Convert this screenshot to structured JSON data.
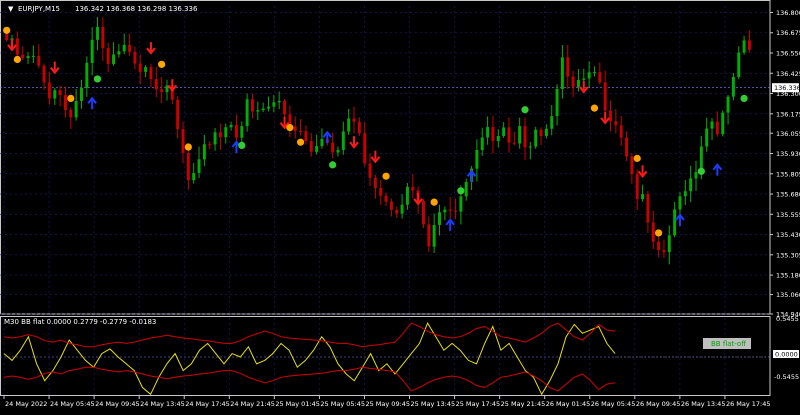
{
  "window": {
    "symbol_label": "EURJPY,M15",
    "ohlc_text": "136.342 136.368 136.298 136.336",
    "menu_glyph": "▼"
  },
  "indicator": {
    "label": "M30 BB flat 0.0000 0.2779 -0.2779 -0.0183",
    "status_badge": "BB flat-off",
    "zero_label": "0.0000",
    "y_labels": [
      "0.5455",
      "-0.5455"
    ]
  },
  "colors": {
    "background": "#000000",
    "grid": "#1c1c7a",
    "bull_candle": "#00b000",
    "bear_candle": "#c80000",
    "buy_arrow": "#1e3cff",
    "sell_arrow": "#ff1a1a",
    "green_dot": "#32cd32",
    "orange_dot": "#ffa500",
    "osc_line": "#e8e000",
    "band_line": "#d40000",
    "axis": "#c8c8c8",
    "current_price_box": "#ffffff",
    "badge_bg": "#bfbfbf",
    "badge_text": "#00a000"
  },
  "chart_data": [
    {
      "type": "candlestick",
      "title": "EURJPY,M15",
      "ylim": [
        134.94,
        136.84
      ],
      "y_ticks": [
        136.8,
        136.675,
        136.55,
        136.425,
        136.3,
        136.175,
        136.055,
        135.93,
        135.805,
        135.68,
        135.555,
        135.43,
        135.305,
        135.18,
        135.06,
        134.94
      ],
      "y_tick_labels": [
        "136.800",
        "136.675",
        "136.550",
        "136.425",
        "136.300",
        "136.175",
        "136.055",
        "135.930",
        "135.805",
        "135.680",
        "135.555",
        "135.430",
        "135.305",
        "135.180",
        "135.060",
        "134.940"
      ],
      "current_price": 136.336,
      "current_price_label": "136.336",
      "x_ticks": [
        "24 May 2022",
        "24 May 05:45",
        "24 May 09:45",
        "24 May 13:45",
        "24 May 17:45",
        "24 May 21:45",
        "25 May 01:45",
        "25 May 05:45",
        "25 May 09:45",
        "25 May 13:45",
        "25 May 17:45",
        "25 May 21:45",
        "26 May 01:45",
        "26 May 05:45",
        "26 May 09:45",
        "26 May 13:45",
        "26 May 17:45"
      ],
      "closes": [
        136.63,
        136.56,
        136.48,
        136.53,
        136.42,
        136.3,
        136.36,
        136.21,
        136.2,
        136.34,
        136.52,
        136.69,
        136.45,
        136.5,
        136.55,
        136.6,
        136.47,
        136.5,
        136.38,
        136.33,
        136.22,
        135.98,
        135.74,
        135.8,
        135.95,
        136.08,
        136.05,
        136.15,
        136.05,
        136.22,
        136.15,
        136.2,
        136.22,
        136.25,
        136.13,
        136.1,
        136.05,
        135.97,
        136.08,
        135.95,
        135.9,
        136.15,
        136.12,
        135.95,
        135.8,
        135.72,
        135.65,
        135.61,
        135.68,
        135.7,
        135.55,
        135.35,
        135.5,
        135.65,
        135.6,
        135.72,
        135.85,
        136.02,
        136.05,
        135.98,
        136.05,
        135.9,
        136.05,
        136.0,
        136.12,
        136.05,
        136.25,
        136.52,
        136.3,
        136.35,
        136.35,
        136.42,
        136.28,
        136.18,
        136.1,
        135.92,
        135.7,
        135.6,
        135.35,
        135.25,
        135.42,
        135.6,
        135.75,
        135.8,
        136.03,
        136.15,
        136.1,
        136.2,
        136.45,
        136.58,
        136.55,
        136.35
      ],
      "signals": [
        {
          "type": "sell_arrow",
          "index": 1,
          "price": 136.6
        },
        {
          "type": "orange_dot",
          "index": 0,
          "price": 136.69
        },
        {
          "type": "orange_dot",
          "index": 2,
          "price": 136.51
        },
        {
          "type": "sell_arrow",
          "index": 9,
          "price": 136.46
        },
        {
          "type": "orange_dot",
          "index": 12,
          "price": 136.27
        },
        {
          "type": "green_dot",
          "index": 17,
          "price": 136.39
        },
        {
          "type": "buy_arrow",
          "index": 16,
          "price": 136.24
        },
        {
          "type": "sell_arrow",
          "index": 27,
          "price": 136.58
        },
        {
          "type": "orange_dot",
          "index": 29,
          "price": 136.48
        },
        {
          "type": "sell_arrow",
          "index": 31,
          "price": 136.35
        },
        {
          "type": "orange_dot",
          "index": 34,
          "price": 135.97
        },
        {
          "type": "buy_arrow",
          "index": 43,
          "price": 135.97
        },
        {
          "type": "green_dot",
          "index": 44,
          "price": 135.98
        },
        {
          "type": "sell_arrow",
          "index": 52,
          "price": 136.12
        },
        {
          "type": "orange_dot",
          "index": 53,
          "price": 136.09
        },
        {
          "type": "orange_dot",
          "index": 55,
          "price": 136.0
        },
        {
          "type": "buy_arrow",
          "index": 60,
          "price": 136.03
        },
        {
          "type": "green_dot",
          "index": 61,
          "price": 135.86
        },
        {
          "type": "sell_arrow",
          "index": 65,
          "price": 136.0
        },
        {
          "type": "sell_arrow",
          "index": 69,
          "price": 135.91
        },
        {
          "type": "orange_dot",
          "index": 71,
          "price": 135.79
        },
        {
          "type": "sell_arrow",
          "index": 77,
          "price": 135.65
        },
        {
          "type": "orange_dot",
          "index": 80,
          "price": 135.63
        },
        {
          "type": "green_dot",
          "index": 85,
          "price": 135.7
        },
        {
          "type": "buy_arrow",
          "index": 83,
          "price": 135.49
        },
        {
          "type": "buy_arrow",
          "index": 87,
          "price": 135.79
        },
        {
          "type": "green_dot",
          "index": 97,
          "price": 136.2
        },
        {
          "type": "sell_arrow",
          "index": 108,
          "price": 136.34
        },
        {
          "type": "orange_dot",
          "index": 110,
          "price": 136.21
        },
        {
          "type": "sell_arrow",
          "index": 112,
          "price": 136.15
        },
        {
          "type": "orange_dot",
          "index": 118,
          "price": 135.9
        },
        {
          "type": "sell_arrow",
          "index": 119,
          "price": 135.82
        },
        {
          "type": "orange_dot",
          "index": 122,
          "price": 135.44
        },
        {
          "type": "buy_arrow",
          "index": 126,
          "price": 135.52
        },
        {
          "type": "green_dot",
          "index": 130,
          "price": 135.82
        },
        {
          "type": "buy_arrow",
          "index": 133,
          "price": 135.83
        },
        {
          "type": "green_dot",
          "index": 138,
          "price": 136.27
        }
      ]
    },
    {
      "type": "line",
      "title": "M30 BB flat 0.0000 0.2779 -0.2779 -0.0183",
      "ylim": [
        -0.5455,
        0.5455
      ],
      "series": [
        {
          "values": [
            0.05,
            -0.05,
            0.1,
            0.3,
            -0.1,
            -0.35,
            -0.2,
            0.0,
            0.25,
            0.1,
            -0.05,
            -0.15,
            0.05,
            0.12,
            0.0,
            -0.1,
            -0.2,
            -0.45,
            -0.55,
            -0.3,
            -0.1,
            0.05,
            -0.2,
            -0.1,
            0.1,
            0.2,
            0.05,
            -0.1,
            0.05,
            0.0,
            0.15,
            -0.1,
            -0.05,
            0.05,
            0.2,
            0.1,
            -0.15,
            -0.05,
            0.1,
            0.3,
            0.15,
            -0.1,
            -0.25,
            -0.35,
            -0.15,
            0.05,
            -0.2,
            -0.1,
            -0.25,
            -0.1,
            0.05,
            0.2,
            0.5,
            0.3,
            0.1,
            0.2,
            0.1,
            -0.05,
            -0.1,
            0.2,
            0.45,
            0.1,
            0.2,
            0.0,
            -0.2,
            -0.3,
            -0.55,
            -0.35,
            -0.1,
            0.3,
            0.48,
            0.35,
            0.4,
            0.45,
            0.2,
            0.05
          ]
        },
        {
          "values": [
            0.3,
            0.28,
            0.3,
            0.33,
            0.3,
            0.24,
            0.22,
            0.25,
            0.2,
            0.18,
            0.15,
            0.15,
            0.18,
            0.2,
            0.22,
            0.2,
            0.22,
            0.25,
            0.28,
            0.3,
            0.32,
            0.3,
            0.28,
            0.27,
            0.25,
            0.24,
            0.22,
            0.2,
            0.2,
            0.24,
            0.3,
            0.34,
            0.38,
            0.35,
            0.3,
            0.28,
            0.27,
            0.26,
            0.25,
            0.24,
            0.22,
            0.2,
            0.2,
            0.18,
            0.15,
            0.17,
            0.18,
            0.2,
            0.22,
            0.35,
            0.5,
            0.45,
            0.38,
            0.33,
            0.3,
            0.28,
            0.3,
            0.35,
            0.42,
            0.45,
            0.38,
            0.3,
            0.28,
            0.25,
            0.22,
            0.28,
            0.35,
            0.45,
            0.5,
            0.4,
            0.3,
            0.25,
            0.35,
            0.48,
            0.4,
            0.38
          ]
        },
        {
          "values": [
            -0.3,
            -0.28,
            -0.3,
            -0.33,
            -0.3,
            -0.24,
            -0.22,
            -0.25,
            -0.2,
            -0.18,
            -0.15,
            -0.15,
            -0.18,
            -0.2,
            -0.22,
            -0.2,
            -0.22,
            -0.25,
            -0.28,
            -0.3,
            -0.32,
            -0.3,
            -0.28,
            -0.27,
            -0.25,
            -0.24,
            -0.22,
            -0.2,
            -0.2,
            -0.24,
            -0.3,
            -0.34,
            -0.38,
            -0.35,
            -0.3,
            -0.28,
            -0.27,
            -0.26,
            -0.25,
            -0.24,
            -0.22,
            -0.2,
            -0.2,
            -0.18,
            -0.15,
            -0.17,
            -0.18,
            -0.2,
            -0.22,
            -0.35,
            -0.5,
            -0.45,
            -0.38,
            -0.33,
            -0.3,
            -0.28,
            -0.3,
            -0.35,
            -0.42,
            -0.45,
            -0.38,
            -0.3,
            -0.28,
            -0.25,
            -0.22,
            -0.28,
            -0.35,
            -0.45,
            -0.5,
            -0.4,
            -0.3,
            -0.25,
            -0.35,
            -0.48,
            -0.4,
            -0.38
          ]
        }
      ]
    }
  ]
}
